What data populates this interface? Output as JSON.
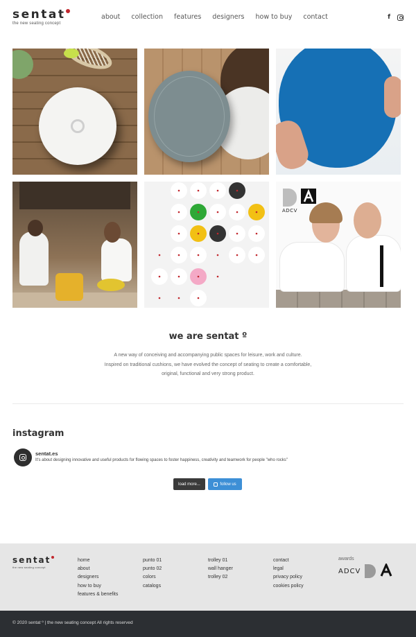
{
  "brand": {
    "name": "sentat",
    "tagline": "the new seating concept",
    "accent_color": "#c1272d"
  },
  "nav": {
    "items": [
      "about",
      "collection",
      "features",
      "designers",
      "how to buy",
      "contact"
    ]
  },
  "social": {
    "facebook": "f",
    "instagram_icon": "instagram-icon"
  },
  "gallery": {
    "award_logo_text": "ADCV"
  },
  "about": {
    "title": "we are sentat º",
    "line1": "A new way of conceiving and accompanying public spaces for leisure, work and culture.",
    "line2": "Inspired on traditional cushions, we have evolved the concept of seating to create a comfortable,",
    "line3": "original, functional and very strong product."
  },
  "instagram": {
    "title": "instagram",
    "username": "sentat.es",
    "bio": "It's about designing innovative and useful products for flowing spaces to foster happiness, creativity and teamwork for people \"who rocks\"",
    "load_more": "load more...",
    "follow": "follow us"
  },
  "footer": {
    "col1": [
      "home",
      "about",
      "designers",
      "how to buy",
      "features & benefits"
    ],
    "col2": [
      "punto 01",
      "punto 02",
      "colors",
      "catalogs"
    ],
    "col3": [
      "trolley 01",
      "wall hanger",
      "trolley 02"
    ],
    "col4": [
      "contact",
      "legal",
      "privacy policy",
      "cookies policy"
    ],
    "awards_label": "awards",
    "award_adcv": "ADCV",
    "copyright": "© 2020 sentat º | the new seating concept All rights reserved"
  }
}
